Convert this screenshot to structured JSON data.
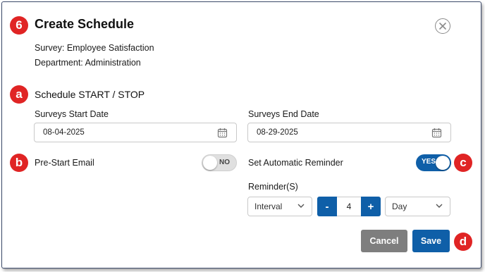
{
  "colors": {
    "badge": "#e02424",
    "primary": "#0f5fa8",
    "cancel": "#7e7e7e"
  },
  "badges": {
    "title": "6",
    "section": "a",
    "prestart": "b",
    "reminder": "c",
    "save": "d"
  },
  "dialog": {
    "title": "Create Schedule",
    "close_icon": "close-circle-icon",
    "survey_line": "Survey: Employee Satisfaction",
    "department_line": "Department: Administration"
  },
  "schedule": {
    "section_title": "Schedule START / STOP",
    "start_label": "Surveys Start Date",
    "start_value": "08-04-2025",
    "end_label": "Surveys End Date",
    "end_value": "08-29-2025",
    "calendar_icon": "calendar-icon"
  },
  "prestart": {
    "label": "Pre-Start Email",
    "toggle_text": "NO",
    "enabled": false
  },
  "auto_reminder": {
    "label": "Set Automatic Reminder",
    "toggle_text": "YES",
    "enabled": true
  },
  "reminders": {
    "label": "Reminder(S)",
    "interval_value": "Interval",
    "minus": "-",
    "count": "4",
    "plus": "+",
    "unit_value": "Day"
  },
  "actions": {
    "cancel": "Cancel",
    "save": "Save"
  }
}
